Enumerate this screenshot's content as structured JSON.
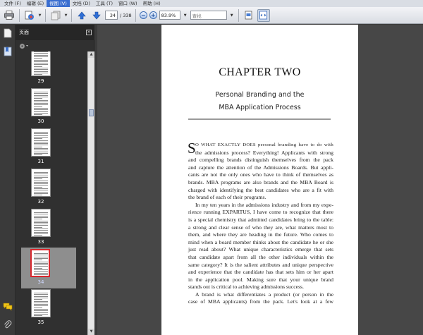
{
  "menu": [
    "文件 (F)",
    "编辑 (E)",
    "视图 (V)",
    "文档 (D)",
    "工具 (T)",
    "窗口 (W)",
    "帮助 (H)"
  ],
  "toolbar": {
    "page_number": "34",
    "page_total": "/ 338",
    "zoom": "83.9%",
    "search_placeholder": "查找"
  },
  "panel": {
    "title": "页面"
  },
  "thumbnails": [
    {
      "label": "29"
    },
    {
      "label": "30"
    },
    {
      "label": "31"
    },
    {
      "label": "32"
    },
    {
      "label": "33"
    },
    {
      "label": "34",
      "selected": true
    },
    {
      "label": "35"
    }
  ],
  "document": {
    "chapter_title": "CHAPTER TWO",
    "subtitle_line1": "Personal Branding and the",
    "subtitle_line2": "MBA Application Process",
    "drop_cap": "S",
    "lines": [
      {
        "t": "O WHAT EXACTLY DOES personal branding have to do with",
        "k": "drop caps"
      },
      {
        "t": "the admissions process? Everything! Applicants with strong",
        "k": "drop"
      },
      {
        "t": "and compelling brands distinguish themselves from the pack",
        "k": ""
      },
      {
        "t": "and capture the attention of the Admissions Boards. But appli-",
        "k": ""
      },
      {
        "t": "cants are not the only ones who have to think of themselves as",
        "k": ""
      },
      {
        "t": "brands. MBA programs are also brands and the MBA Board is",
        "k": ""
      },
      {
        "t": "charged with identifying the best candidates who are a fit with",
        "k": ""
      },
      {
        "t": "the brand of each of their programs.",
        "k": "last"
      },
      {
        "t": "In my ten years in the admissions industry and from my expe-",
        "k": "indent"
      },
      {
        "t": "rience running EXPARTUS, I have come to recognize that there",
        "k": ""
      },
      {
        "t": "is a special chemistry that admitted candidates bring to the table:",
        "k": ""
      },
      {
        "t": "a strong and clear sense of who they are, what matters most to",
        "k": ""
      },
      {
        "t": "them, and where they are heading in the future. Who comes to",
        "k": ""
      },
      {
        "t": "mind when a board member thinks about the candidate he or she",
        "k": ""
      },
      {
        "t": "just read about? What unique characteristics emerge that sets",
        "k": ""
      },
      {
        "t": "that candidate apart from all the other individuals within the",
        "k": ""
      },
      {
        "t": "same category? It is the salient attributes and unique perspective",
        "k": ""
      },
      {
        "t": "and experience that the candidate has that sets him or her apart",
        "k": ""
      },
      {
        "t": "in the application pool. Making sure that your unique brand",
        "k": ""
      },
      {
        "t": "stands out is critical to achieving admissions success.",
        "k": "last"
      },
      {
        "t": "A brand is what differentiates a product (or person in the",
        "k": "indent"
      },
      {
        "t": "case of MBA applicants) from the pack. Let's look at a few",
        "k": ""
      }
    ]
  },
  "colors": {
    "selection_border": "#d8262c",
    "menu_active": "#3a6ed0",
    "nav_arrow": "#2f6fd6"
  }
}
